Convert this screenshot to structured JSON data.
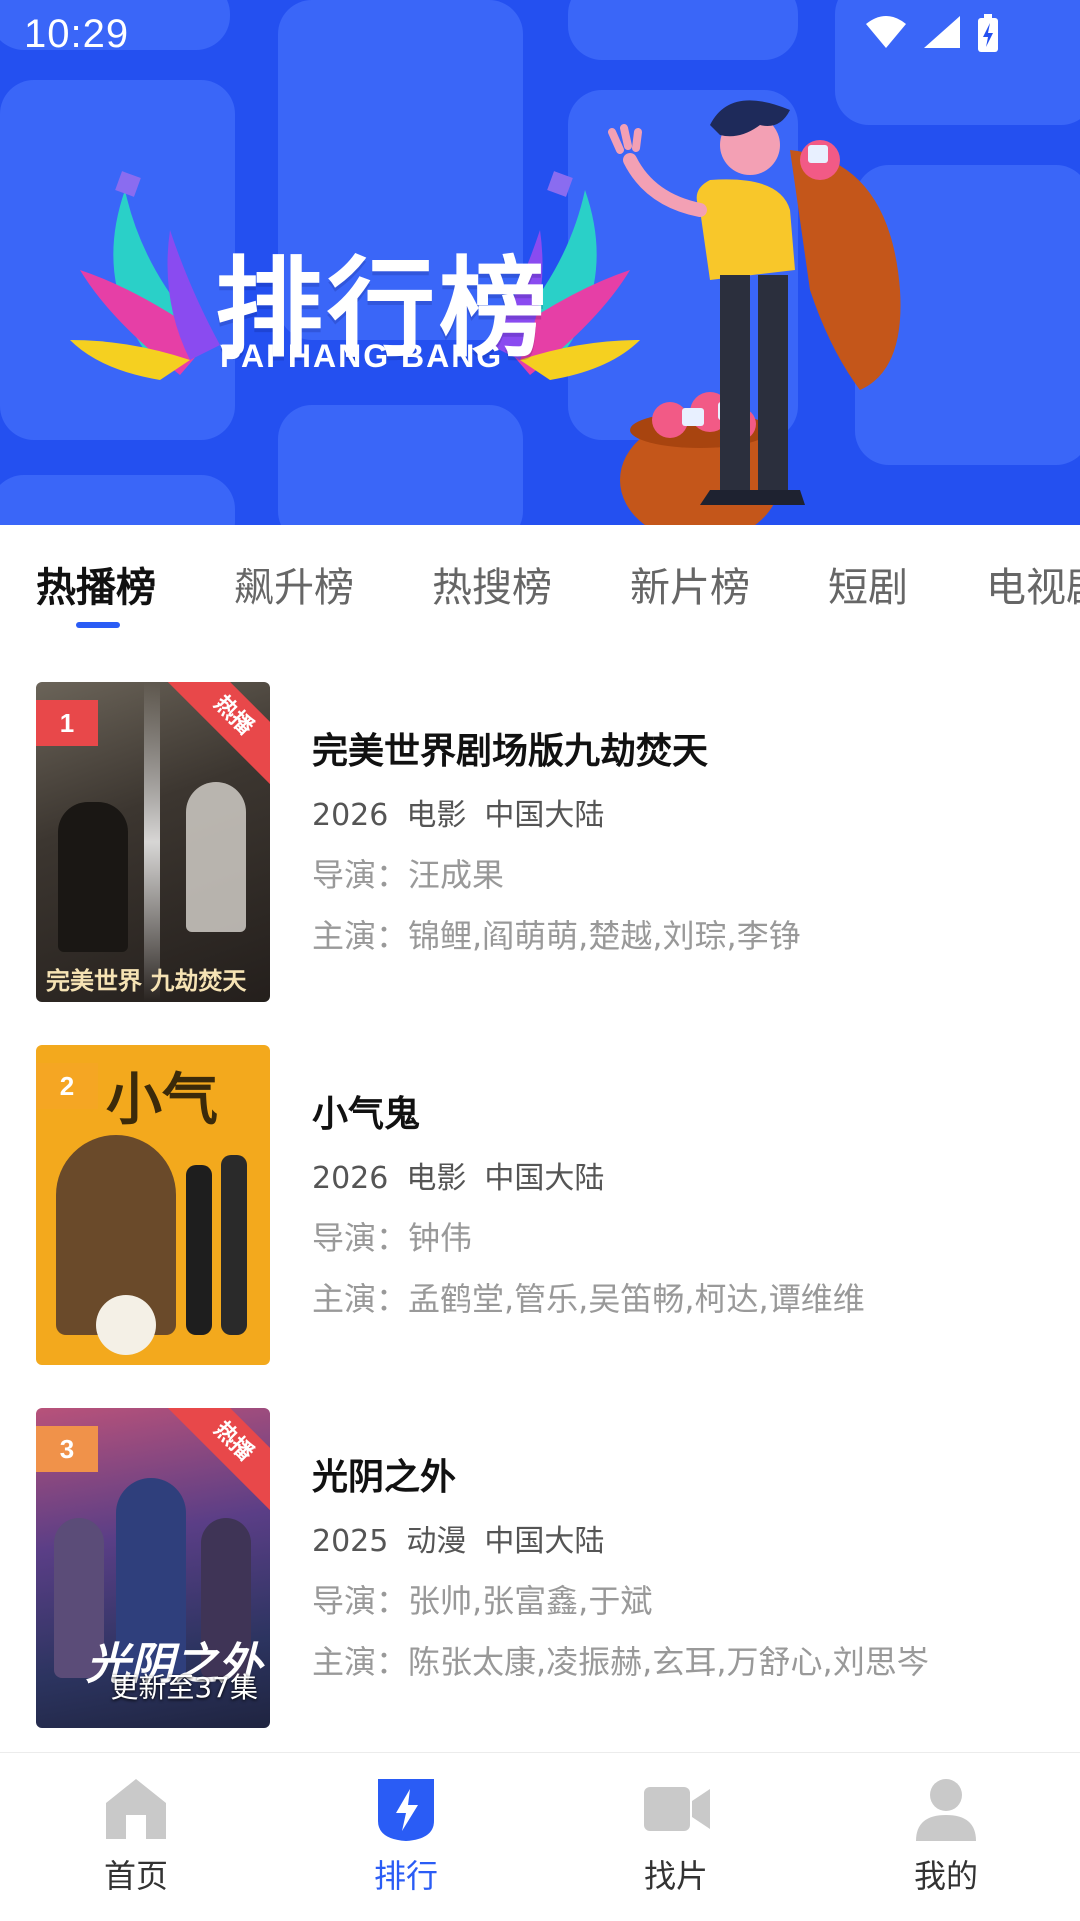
{
  "status": {
    "time": "10:29"
  },
  "banner": {
    "title": "排行榜",
    "subtitle": "PAI HANG BANG"
  },
  "tabs": [
    {
      "label": "热播榜",
      "active": true
    },
    {
      "label": "飙升榜"
    },
    {
      "label": "热搜榜"
    },
    {
      "label": "新片榜"
    },
    {
      "label": "短剧"
    },
    {
      "label": "电视剧"
    }
  ],
  "items": [
    {
      "rank": "1",
      "rank_color": "#e8484a",
      "badge": "热播",
      "poster_art": "完美世界 九劫焚天",
      "title": "完美世界剧场版九劫焚天",
      "year": "2026",
      "type": "电影",
      "region": "中国大陆",
      "director": "导演：汪成果",
      "cast": "主演：锦鲤,阎萌萌,楚越,刘琮,李铮"
    },
    {
      "rank": "2",
      "rank_color": "#f5a623",
      "badge": "",
      "poster_art": "小气鬼",
      "title": "小气鬼",
      "year": "2026",
      "type": "电影",
      "region": "中国大陆",
      "director": "导演：钟伟",
      "cast": "主演：孟鹤堂,管乐,吴笛畅,柯达,谭维维"
    },
    {
      "rank": "3",
      "rank_color": "#f0924a",
      "badge": "热播",
      "poster_art": "光阴之外",
      "update": "更新至37集",
      "title": "光阴之外",
      "year": "2025",
      "type": "动漫",
      "region": "中国大陆",
      "director": "导演：张帅,张富鑫,于斌",
      "cast": "主演：陈张太康,凌振赫,玄耳,万舒心,刘思岑"
    }
  ],
  "nav": [
    {
      "label": "首页",
      "icon": "home-icon"
    },
    {
      "label": "排行",
      "icon": "ranking-icon",
      "active": true
    },
    {
      "label": "找片",
      "icon": "video-icon"
    },
    {
      "label": "我的",
      "icon": "profile-icon"
    }
  ],
  "colors": {
    "accent": "#2a5cf5",
    "banner_bg": "#2450f0",
    "hot": "#e8484a"
  }
}
